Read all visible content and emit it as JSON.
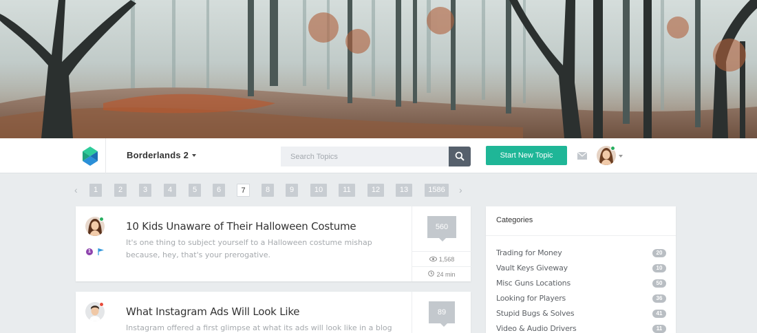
{
  "header": {
    "forum_title": "Borderlands 2",
    "search_placeholder": "Search Topics",
    "new_topic_label": "Start New Topic"
  },
  "pagination": {
    "pages": [
      "1",
      "2",
      "3",
      "4",
      "5",
      "6",
      "7",
      "8",
      "9",
      "10",
      "11",
      "12",
      "13",
      "1586"
    ],
    "current": "7"
  },
  "topics": [
    {
      "title": "10 Kids Unaware of Their Halloween Costume",
      "excerpt": "It's one thing to subject yourself to a Halloween costume mishap because, hey, that's your prerogative.",
      "replies": "560",
      "views": "1,568",
      "time": "24 min",
      "badge": "1",
      "status_color": "#27ae60"
    },
    {
      "title": "What Instagram Ads Will Look Like",
      "excerpt": "Instagram offered a first glimpse at what its ads will look like in a blog post",
      "replies": "89",
      "status_color": "#e74c3c"
    }
  ],
  "categories": {
    "title": "Categories",
    "items": [
      {
        "label": "Trading for Money",
        "count": "20"
      },
      {
        "label": "Vault Keys Giveway",
        "count": "10"
      },
      {
        "label": "Misc Guns Locations",
        "count": "50"
      },
      {
        "label": "Looking for Players",
        "count": "36"
      },
      {
        "label": "Stupid Bugs & Solves",
        "count": "41"
      },
      {
        "label": "Video & Audio Drivers",
        "count": "11"
      }
    ]
  },
  "colors": {
    "accent": "#1fb697",
    "search_button": "#56606c",
    "online": "#27ae60",
    "badge": "#8e44ad"
  }
}
